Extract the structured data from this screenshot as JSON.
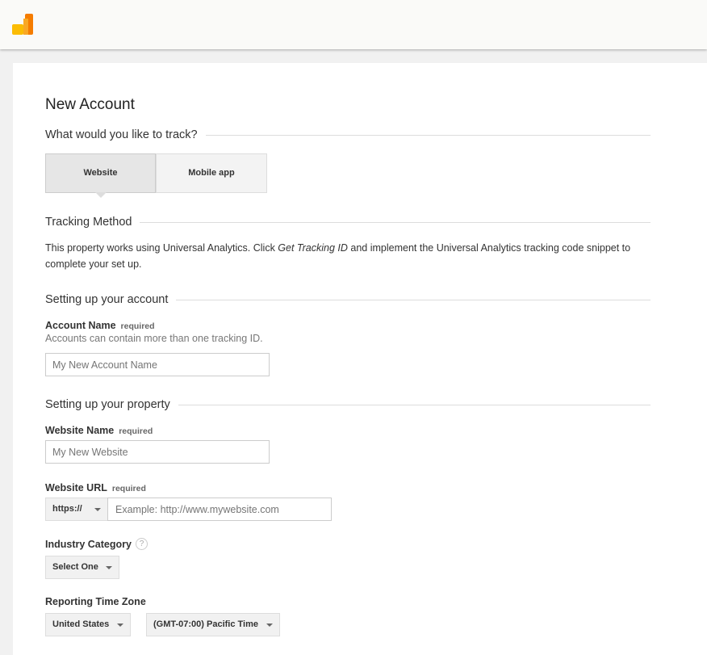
{
  "header": {
    "logo": "google-analytics-logo"
  },
  "page": {
    "title": "New Account"
  },
  "track": {
    "heading": "What would you like to track?",
    "options": [
      "Website",
      "Mobile app"
    ],
    "selected": "Website"
  },
  "tracking_method": {
    "heading": "Tracking Method",
    "text_before": "This property works using Universal Analytics. Click ",
    "text_em": "Get Tracking ID",
    "text_after": " and implement the Universal Analytics tracking code snippet to complete your set up."
  },
  "account": {
    "heading": "Setting up your account",
    "name_label": "Account Name",
    "required": "required",
    "hint": "Accounts can contain more than one tracking ID.",
    "name_placeholder": "My New Account Name"
  },
  "property": {
    "heading": "Setting up your property",
    "website_name_label": "Website Name",
    "required": "required",
    "website_name_placeholder": "My New Website",
    "url_label": "Website URL",
    "protocol": "https://",
    "url_placeholder": "Example: http://www.mywebsite.com",
    "industry_label": "Industry Category",
    "industry_value": "Select One",
    "timezone_label": "Reporting Time Zone",
    "country": "United States",
    "timezone": "(GMT-07:00) Pacific Time"
  },
  "colors": {
    "logo_yellow": "#fbbc04",
    "logo_orange": "#f57c00"
  }
}
